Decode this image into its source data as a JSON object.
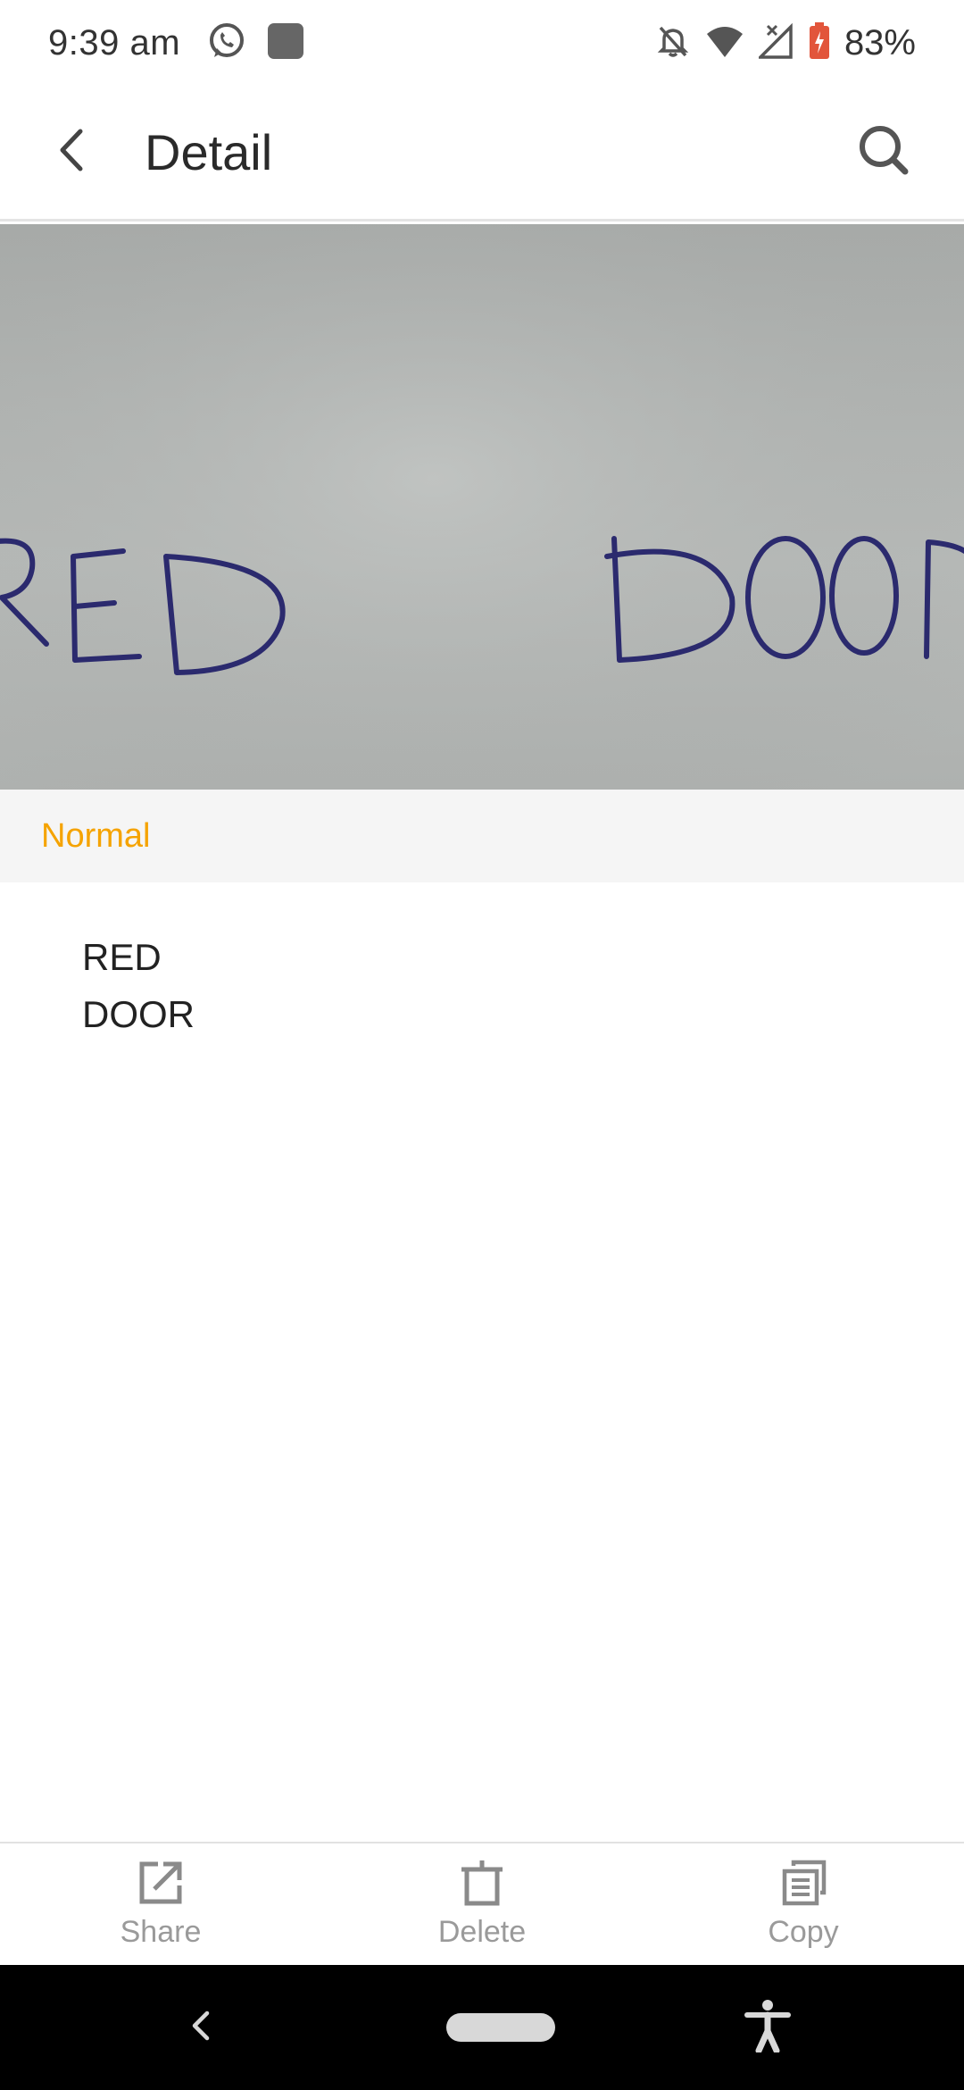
{
  "status_bar": {
    "time": "9:39 am",
    "battery_percent": "83%",
    "icons": [
      "whatsapp-icon",
      "app-notification-icon",
      "bell-off-icon",
      "wifi-icon",
      "signal-icon",
      "battery-icon"
    ]
  },
  "app_bar": {
    "title": "Detail",
    "back_icon": "chevron-left-icon",
    "search_icon": "search-icon"
  },
  "photo": {
    "handwritten_text": [
      "RED",
      "DOOR"
    ],
    "ink_color": "#2b2a6e"
  },
  "mode": {
    "label": "Normal",
    "color": "#f5a300"
  },
  "result": {
    "lines": [
      "RED",
      "DOOR"
    ]
  },
  "actions": [
    {
      "label": "Share",
      "icon": "share-icon"
    },
    {
      "label": "Delete",
      "icon": "trash-icon"
    },
    {
      "label": "Copy",
      "icon": "copy-icon"
    }
  ],
  "nav_bar": {
    "icons": [
      "nav-back-icon",
      "home-pill",
      "accessibility-icon"
    ]
  }
}
